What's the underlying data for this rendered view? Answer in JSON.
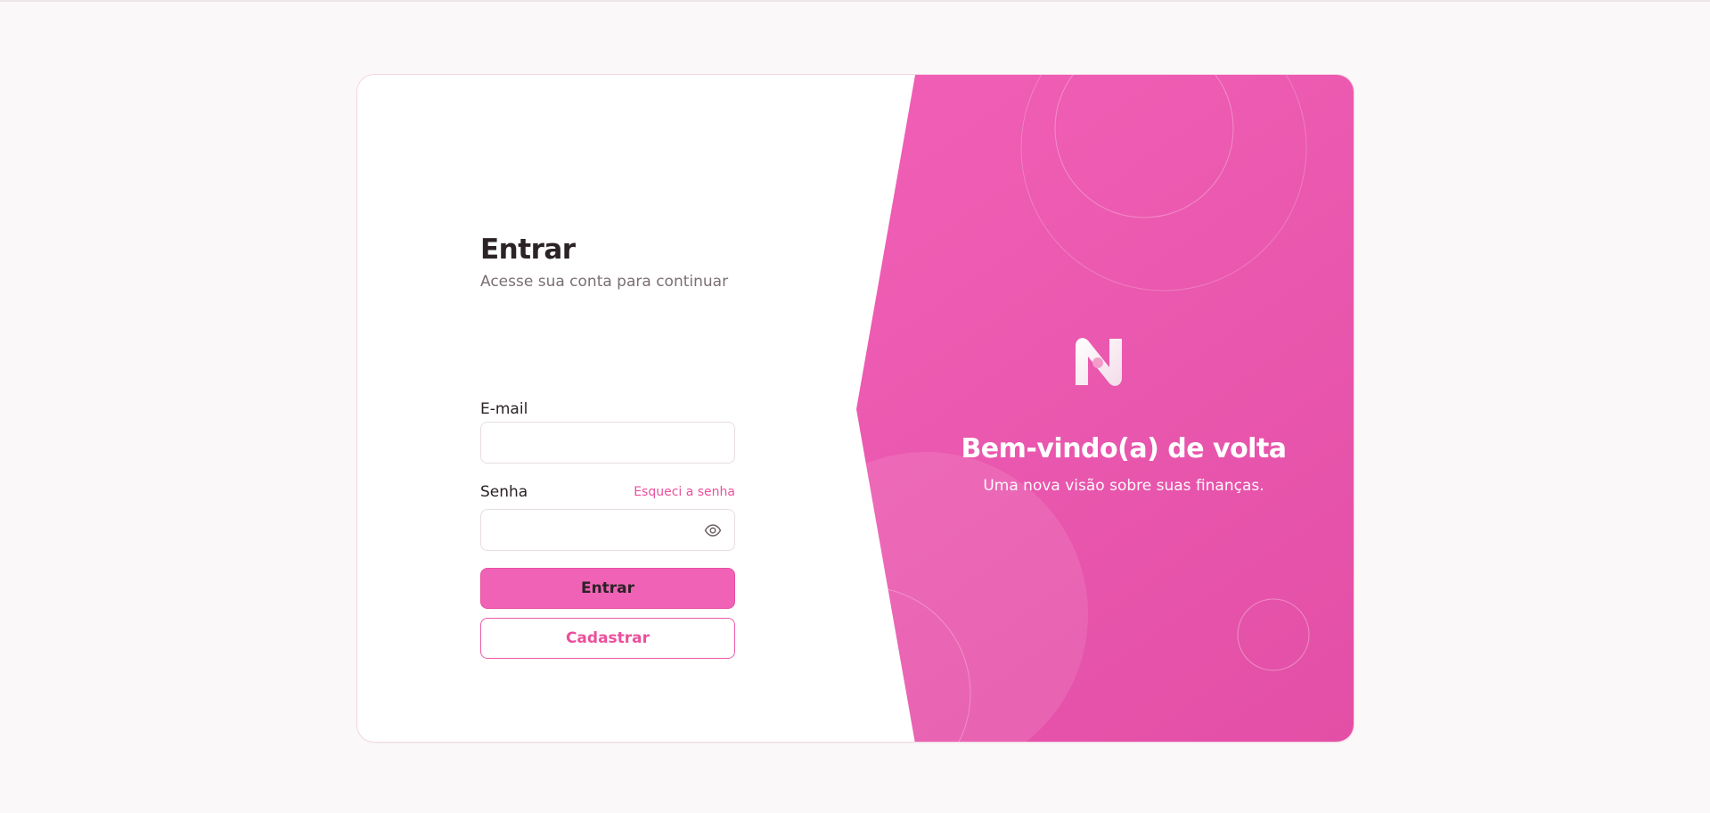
{
  "login": {
    "title": "Entrar",
    "subtitle": "Acesse sua conta para continuar",
    "email_label": "E-mail",
    "email_value": "",
    "password_label": "Senha",
    "password_value": "",
    "forgot_link": "Esqueci a senha",
    "submit_button": "Entrar",
    "register_button": "Cadastrar"
  },
  "welcome": {
    "title": "Bem-vindo(a) de volta",
    "subtitle": "Uma nova visão sobre suas finanças."
  },
  "icons": {
    "logo": "brand-logo-icon",
    "password_toggle": "eye-icon"
  },
  "colors": {
    "accent": "#ef5fb3",
    "accent_dark": "#e34fa6",
    "text_primary": "#2b2326",
    "text_secondary": "#7a6f74",
    "page_background": "#fbf8f9"
  }
}
